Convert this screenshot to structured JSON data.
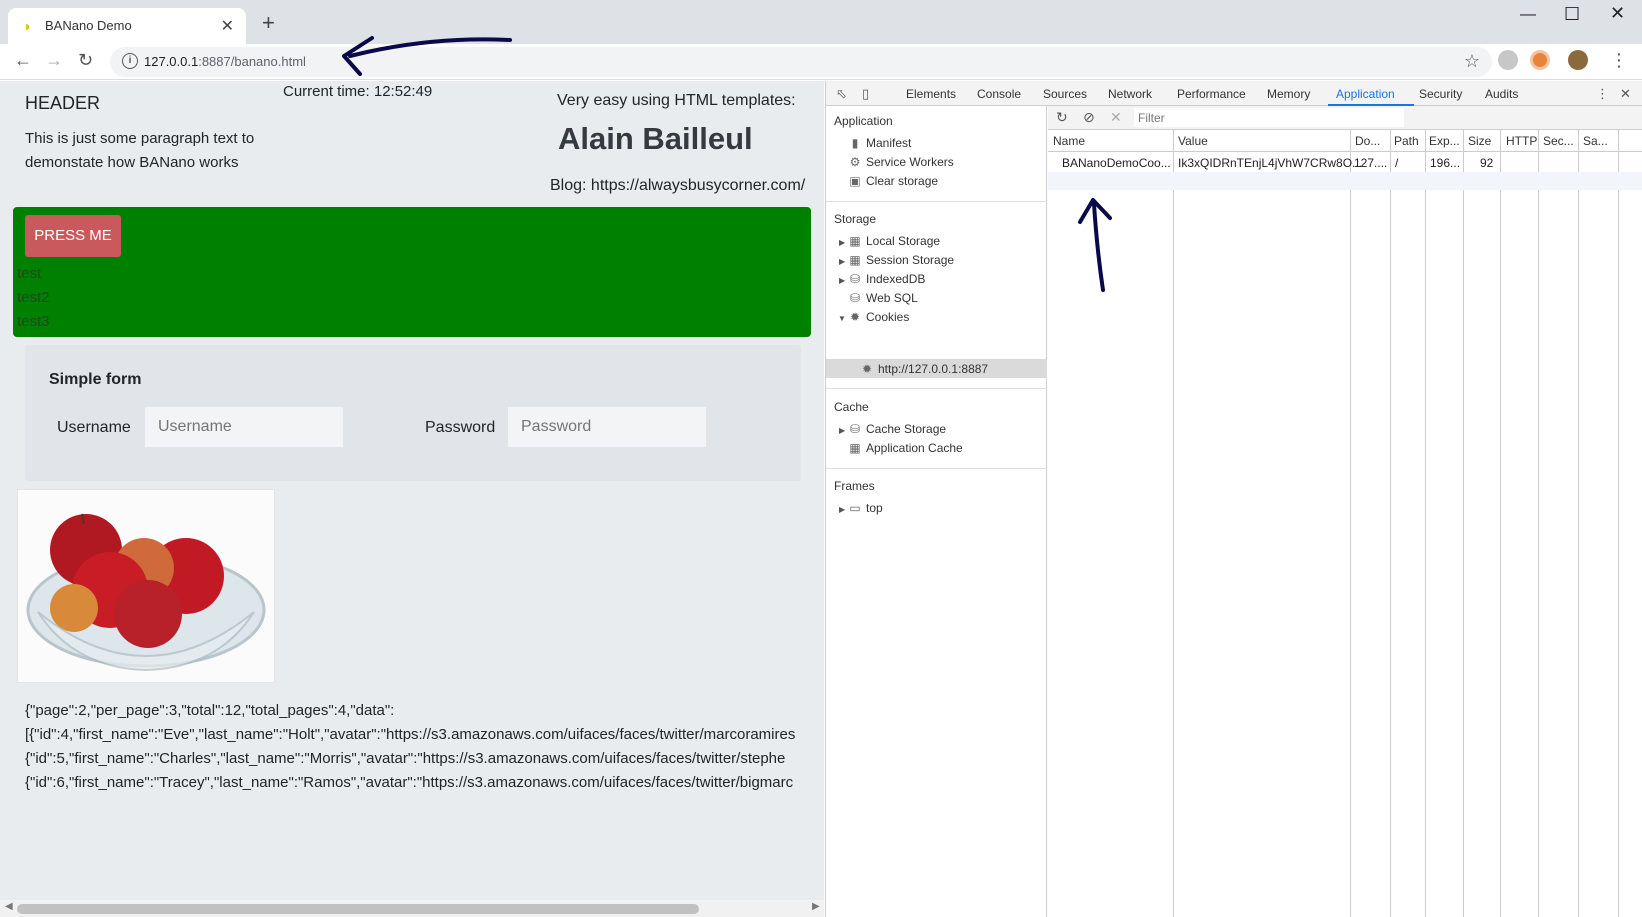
{
  "browser": {
    "tab_title": "BANano Demo",
    "url_host": "127.0.0.1",
    "url_rest": ":8887/banano.html"
  },
  "page": {
    "header": "HEADER",
    "paragraph": "This is just some paragraph text to demonstate how BANano works",
    "current_time": "Current time: 12:52:49",
    "templates_text": "Very easy using HTML templates:",
    "author": "Alain Bailleul",
    "blog": "Blog: https://alwaysbusycorner.com/",
    "press_button": "PRESS ME",
    "green_items": [
      "test",
      "test2",
      "test3"
    ],
    "form": {
      "title": "Simple form",
      "username_label": "Username",
      "username_placeholder": "Username",
      "password_label": "Password",
      "password_placeholder": "Password"
    },
    "json_lines": [
      "{\"page\":2,\"per_page\":3,\"total\":12,\"total_pages\":4,\"data\":",
      "[{\"id\":4,\"first_name\":\"Eve\",\"last_name\":\"Holt\",\"avatar\":\"https://s3.amazonaws.com/uifaces/faces/twitter/marcoramires",
      "{\"id\":5,\"first_name\":\"Charles\",\"last_name\":\"Morris\",\"avatar\":\"https://s3.amazonaws.com/uifaces/faces/twitter/stephe",
      "{\"id\":6,\"first_name\":\"Tracey\",\"last_name\":\"Ramos\",\"avatar\":\"https://s3.amazonaws.com/uifaces/faces/twitter/bigmarc"
    ]
  },
  "devtools": {
    "tabs": [
      "Elements",
      "Console",
      "Sources",
      "Network",
      "Performance",
      "Memory",
      "Application",
      "Security",
      "Audits"
    ],
    "active_tab": "Application",
    "sidebar": {
      "application_header": "Application",
      "application_items": [
        "Manifest",
        "Service Workers",
        "Clear storage"
      ],
      "storage_header": "Storage",
      "storage_items": [
        "Local Storage",
        "Session Storage",
        "IndexedDB",
        "Web SQL",
        "Cookies"
      ],
      "cookie_origin": "http://127.0.0.1:8887",
      "cache_header": "Cache",
      "cache_items": [
        "Cache Storage",
        "Application Cache"
      ],
      "frames_header": "Frames",
      "frames_items": [
        "top"
      ]
    },
    "filter_placeholder": "Filter",
    "columns": [
      "Name",
      "Value",
      "Do...",
      "Path",
      "Exp...",
      "Size",
      "HTTP",
      "Sec...",
      "Sa..."
    ],
    "cookie_row": {
      "name": "BANanoDemoCoo...",
      "value": "Ik3xQIDRnTEnjL4jVhW7CRw8O...",
      "domain": "127....",
      "path": "/",
      "expires": "196...",
      "size": "92"
    }
  },
  "colors": {
    "green_panel": "#008000",
    "press_button": "#c9595c",
    "devtools_accent": "#1a73e8",
    "annotation_arrow": "#0a0a4a"
  }
}
